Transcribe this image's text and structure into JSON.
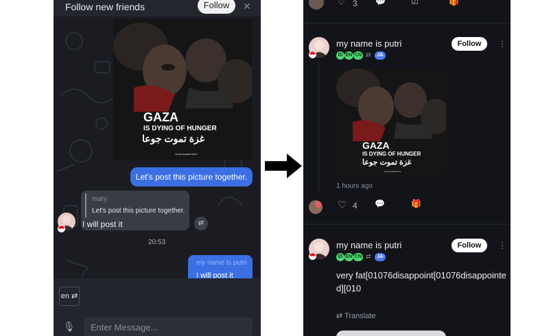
{
  "chat": {
    "banner": {
      "text": "Follow new friends",
      "follow_label": "Follow",
      "close_icon": "✕"
    },
    "image": {
      "headline": "GAZA",
      "line2": "IS DYING OF HUNGER",
      "arabic": "غزة تموت جوعا",
      "credit": "@eyeonpalestine"
    },
    "outgoing_message": "Let's post this picture together.",
    "reply": {
      "quoted_name": "mary",
      "quoted_text": "Let's post this picture together.",
      "text": "I will post it"
    },
    "translate_icon": "translate-icon",
    "time": "20:53",
    "outgoing_reply": {
      "quoted_name": "my name is putri",
      "text": "I will post it"
    },
    "bottom": {
      "lang_label": "en ⇄",
      "placeholder": "Enter Message..."
    }
  },
  "feed": {
    "top_actions": {
      "likes": "3"
    },
    "post1": {
      "name": "my name is putri",
      "follow_label": "Follow",
      "languages": [
        "ID",
        "EN",
        "CN"
      ],
      "target_language": "JA",
      "image": {
        "headline": "GAZA",
        "line2": "IS DYING OF HUNGER",
        "arabic": "غزة تموت جوعا",
        "credit": "@eyeonpalestine"
      },
      "time_ago": "1 hours ago",
      "likes": "4"
    },
    "post2": {
      "name": "my name is putri",
      "follow_label": "Follow",
      "languages": [
        "ID",
        "EN",
        "CN"
      ],
      "target_language": "JA",
      "text": "very fat[01076disappoint[01076disappointed][010",
      "translate_label": "Translate"
    }
  },
  "colors": {
    "accent_blue": "#3b6fe3",
    "lang_green": "#4fd46f",
    "lang_blue": "#4d7cf5",
    "dark_bg": "#12141a"
  }
}
